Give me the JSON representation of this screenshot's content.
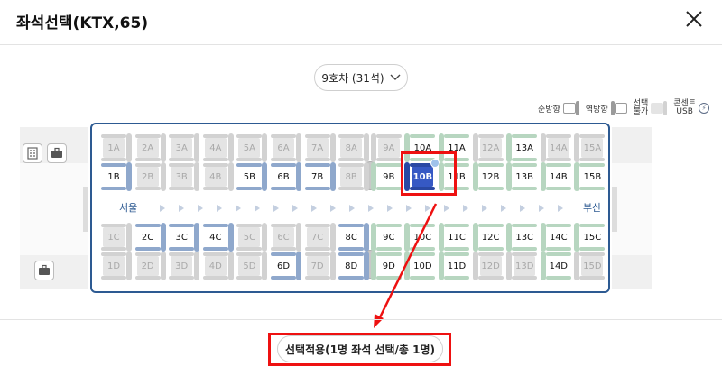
{
  "header": {
    "title": "좌석선택(KTX,65)"
  },
  "car_select": {
    "label": "9호차 (31석)"
  },
  "legend": {
    "forward": "순방향",
    "reverse": "역방향",
    "unavailable_line1": "선택",
    "unavailable_line2": "불가",
    "usb_line1": "콘센트",
    "usb_line2": "USB"
  },
  "direction": {
    "from": "서울",
    "to": "부산"
  },
  "seats_top": [
    {
      "a": "1A",
      "b": "1B",
      "a_state": "sold",
      "b_state": "avail",
      "dir": "fwd"
    },
    {
      "a": "2A",
      "b": "2B",
      "a_state": "sold",
      "b_state": "sold",
      "dir": "fwd"
    },
    {
      "a": "3A",
      "b": "3B",
      "a_state": "sold",
      "b_state": "sold",
      "dir": "fwd"
    },
    {
      "a": "4A",
      "b": "4B",
      "a_state": "sold",
      "b_state": "sold",
      "dir": "fwd"
    },
    {
      "a": "5A",
      "b": "5B",
      "a_state": "sold",
      "b_state": "avail",
      "dir": "fwd"
    },
    {
      "a": "6A",
      "b": "6B",
      "a_state": "sold",
      "b_state": "avail",
      "dir": "fwd"
    },
    {
      "a": "7A",
      "b": "7B",
      "a_state": "sold",
      "b_state": "avail",
      "dir": "fwd"
    },
    {
      "a": "8A",
      "b": "8B",
      "a_state": "sold",
      "b_state": "sold",
      "dir": "fwd"
    },
    {
      "a": "9A",
      "b": "9B",
      "a_state": "sold",
      "b_state": "avail",
      "dir": "rev"
    },
    {
      "a": "10A",
      "b": "10B",
      "a_state": "avail",
      "b_state": "selected",
      "dir": "rev"
    },
    {
      "a": "11A",
      "b": "11B",
      "a_state": "avail",
      "b_state": "avail",
      "dir": "rev"
    },
    {
      "a": "12A",
      "b": "12B",
      "a_state": "sold",
      "b_state": "avail",
      "dir": "rev"
    },
    {
      "a": "13A",
      "b": "13B",
      "a_state": "avail",
      "b_state": "avail",
      "dir": "rev"
    },
    {
      "a": "14A",
      "b": "14B",
      "a_state": "sold",
      "b_state": "avail",
      "dir": "rev"
    },
    {
      "a": "15A",
      "b": "15B",
      "a_state": "sold",
      "b_state": "avail",
      "dir": "rev"
    }
  ],
  "seats_bottom": [
    {
      "c": "1C",
      "d": "1D",
      "c_state": "sold",
      "d_state": "sold",
      "dir": "fwd"
    },
    {
      "c": "2C",
      "d": "2D",
      "c_state": "avail",
      "d_state": "sold",
      "dir": "fwd"
    },
    {
      "c": "3C",
      "d": "3D",
      "c_state": "avail",
      "d_state": "sold",
      "dir": "fwd"
    },
    {
      "c": "4C",
      "d": "4D",
      "c_state": "avail",
      "d_state": "sold",
      "dir": "fwd"
    },
    {
      "c": "5C",
      "d": "5D",
      "c_state": "sold",
      "d_state": "sold",
      "dir": "fwd"
    },
    {
      "c": "6C",
      "d": "6D",
      "c_state": "sold",
      "d_state": "avail",
      "dir": "fwd"
    },
    {
      "c": "7C",
      "d": "7D",
      "c_state": "sold",
      "d_state": "sold",
      "dir": "fwd"
    },
    {
      "c": "8C",
      "d": "8D",
      "c_state": "avail",
      "d_state": "avail",
      "dir": "fwd"
    },
    {
      "c": "9C",
      "d": "9D",
      "c_state": "avail",
      "d_state": "avail",
      "dir": "rev"
    },
    {
      "c": "10C",
      "d": "10D",
      "c_state": "avail",
      "d_state": "avail",
      "dir": "rev"
    },
    {
      "c": "11C",
      "d": "11D",
      "c_state": "avail",
      "d_state": "avail",
      "dir": "rev"
    },
    {
      "c": "12C",
      "d": "12D",
      "c_state": "avail",
      "d_state": "sold",
      "dir": "rev"
    },
    {
      "c": "13C",
      "d": "13D",
      "c_state": "avail",
      "d_state": "sold",
      "dir": "rev"
    },
    {
      "c": "14C",
      "d": "14D",
      "c_state": "avail",
      "d_state": "avail",
      "dir": "rev"
    },
    {
      "c": "15C",
      "d": "15D",
      "c_state": "avail",
      "d_state": "sold",
      "dir": "rev"
    }
  ],
  "apply_button": {
    "label": "선택적용(1명 좌석 선택/총 1명)"
  },
  "colors": {
    "car_border": "#2d5a92",
    "highlight": "#ee1111",
    "selected_seat": "#3659c4"
  }
}
